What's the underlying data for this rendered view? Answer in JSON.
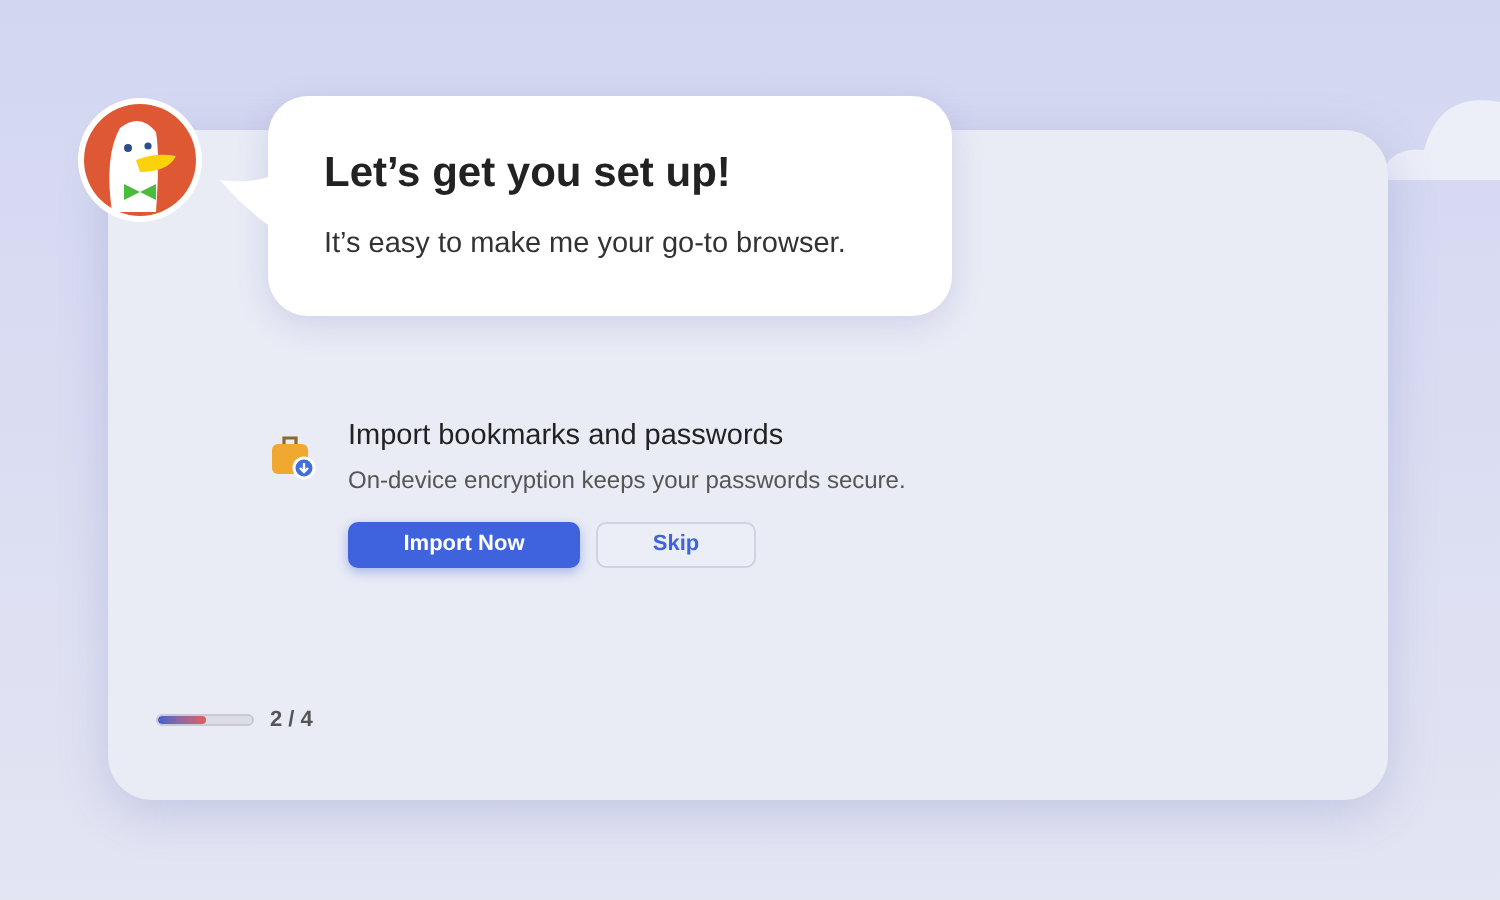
{
  "bubble": {
    "title": "Let’s get you set up!",
    "text": "It’s easy to make me your go-to browser."
  },
  "step": {
    "title": "Import bookmarks and passwords",
    "description": "On-device encryption keeps your passwords secure.",
    "buttons": [
      {
        "label": "Import Now",
        "kind": "primary"
      },
      {
        "label": "Skip",
        "kind": "secondary"
      }
    ]
  },
  "progress": {
    "level": 0.5,
    "reading": "2 / 4"
  }
}
